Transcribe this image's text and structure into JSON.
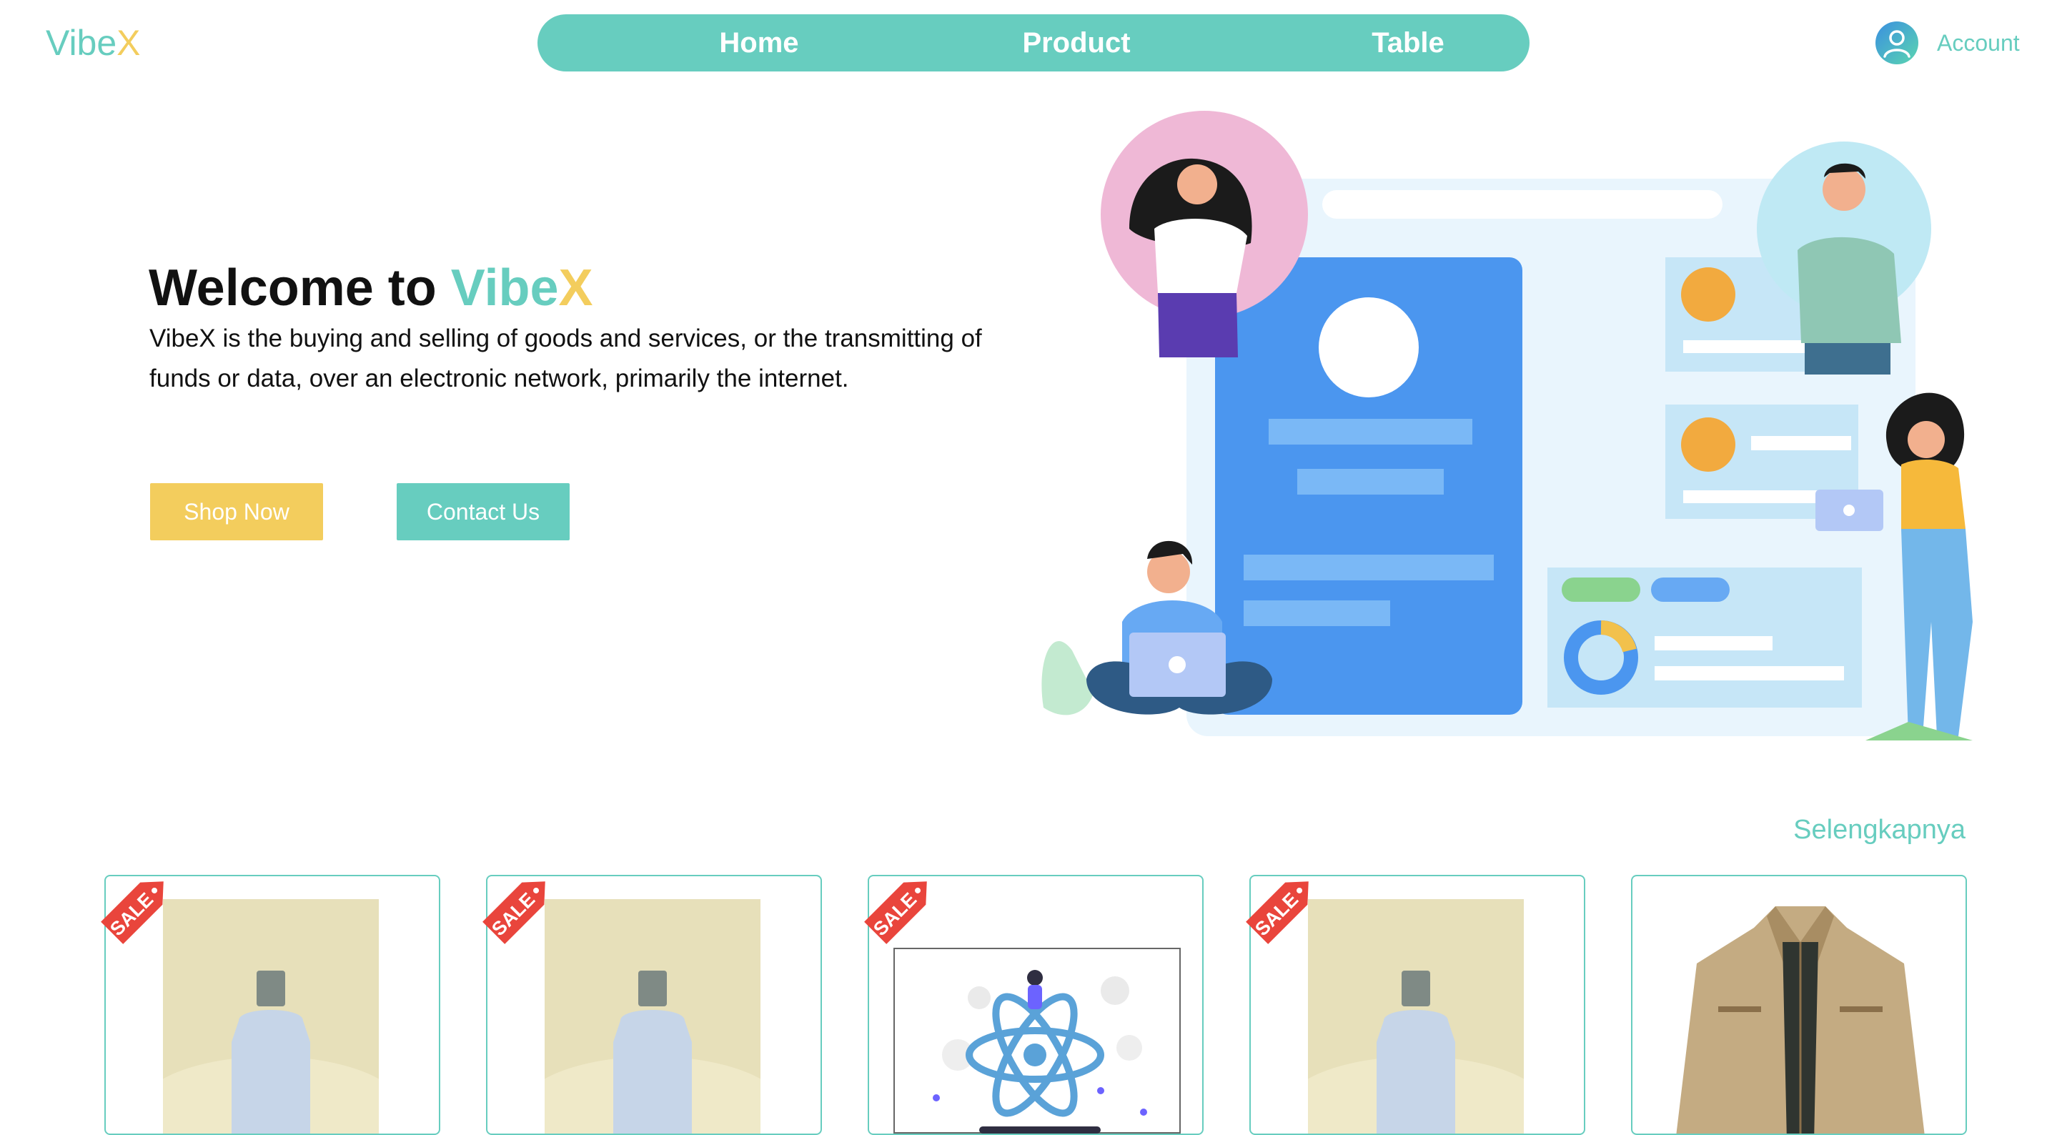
{
  "header": {
    "logo_part1": "Vibe",
    "logo_part2": "X",
    "nav": [
      "Home",
      "Product",
      "Table"
    ],
    "account_label": "Account"
  },
  "hero": {
    "title_prefix": "Welcome to ",
    "title_brand1": "Vibe",
    "title_brand2": "X",
    "description": "VibeX is the buying and selling of goods and services, or the transmitting of funds or data, over an electronic network, primarily the internet.",
    "shop_button": "Shop Now",
    "contact_button": "Contact Us"
  },
  "products": {
    "more_link": "Selengkapnya",
    "sale_tag": "SALE",
    "items": [
      {
        "image": "perfume-bottle",
        "sale": true
      },
      {
        "image": "perfume-bottle",
        "sale": true
      },
      {
        "image": "react-illustration",
        "sale": true
      },
      {
        "image": "perfume-bottle",
        "sale": true
      },
      {
        "image": "khaki-jacket",
        "sale": false
      }
    ]
  },
  "colors": {
    "primary": "#67cdbf",
    "accent": "#f3cd5d",
    "text": "#111111",
    "sale_tag": "#e9453c"
  }
}
